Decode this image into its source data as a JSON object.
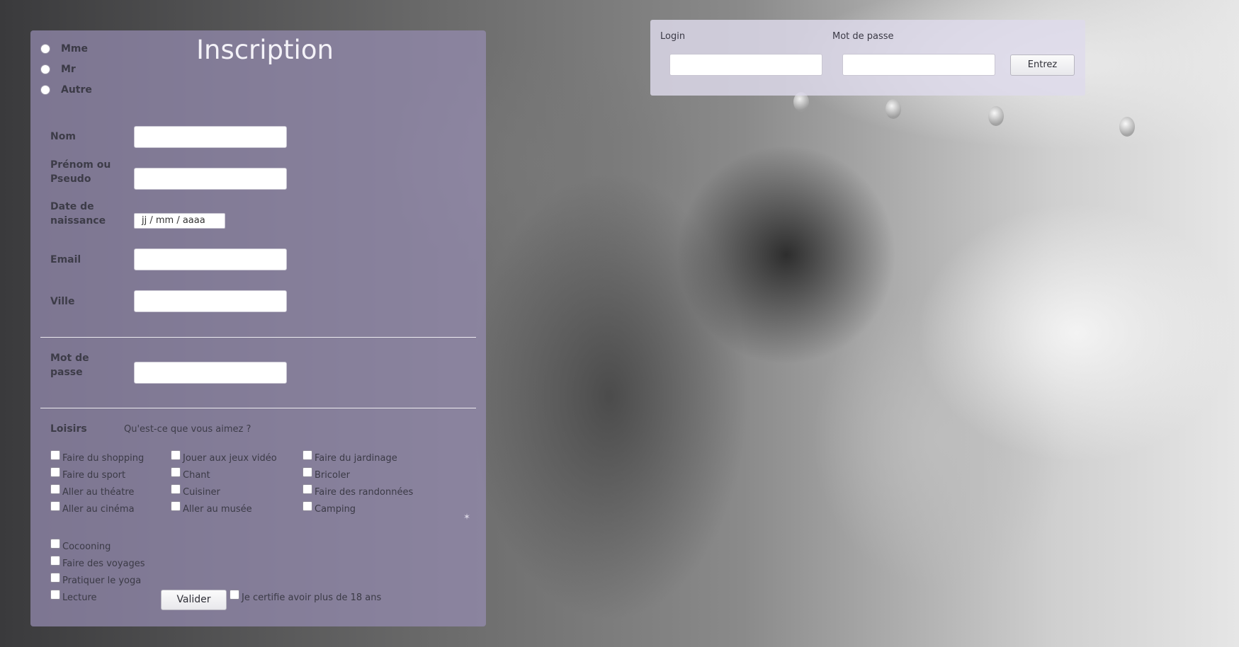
{
  "registration": {
    "title": "Inscription",
    "civility_options": [
      "Mme",
      "Mr",
      "Autre"
    ],
    "fields": {
      "nom_label": "Nom",
      "prenom_label_line1": "Prénom ou",
      "prenom_label_line2": "Pseudo",
      "birth_label_line1": "Date de",
      "birth_label_line2": "naissance",
      "birth_placeholder": "jj / mm / aaaa",
      "email_label": "Email",
      "ville_label": "Ville",
      "password_label_line1": "Mot de",
      "password_label_line2": "passe"
    },
    "hobbies": {
      "title": "Loisirs",
      "question": "Qu'est-ce que vous aimez ?",
      "column1": [
        "Faire du shopping",
        "Faire du sport",
        "Aller au théatre",
        "Aller au cinéma"
      ],
      "column2": [
        "Jouer aux jeux vidéo",
        "Chant",
        "Cuisiner",
        "Aller au musée"
      ],
      "column3": [
        "Faire du jardinage",
        "Bricoler",
        "Faire des randonnées",
        "Camping"
      ],
      "extra": [
        "Cocooning",
        "Faire des voyages",
        "Pratiquer le yoga",
        "Lecture"
      ]
    },
    "submit_label": "Valider",
    "age_confirm_label": "Je certifie avoir plus de 18 ans"
  },
  "login": {
    "login_label": "Login",
    "password_label": "Mot de passe",
    "submit_label": "Entrez"
  },
  "colors": {
    "panel_tint": "#968cb2",
    "login_tint": "#dedaec"
  }
}
